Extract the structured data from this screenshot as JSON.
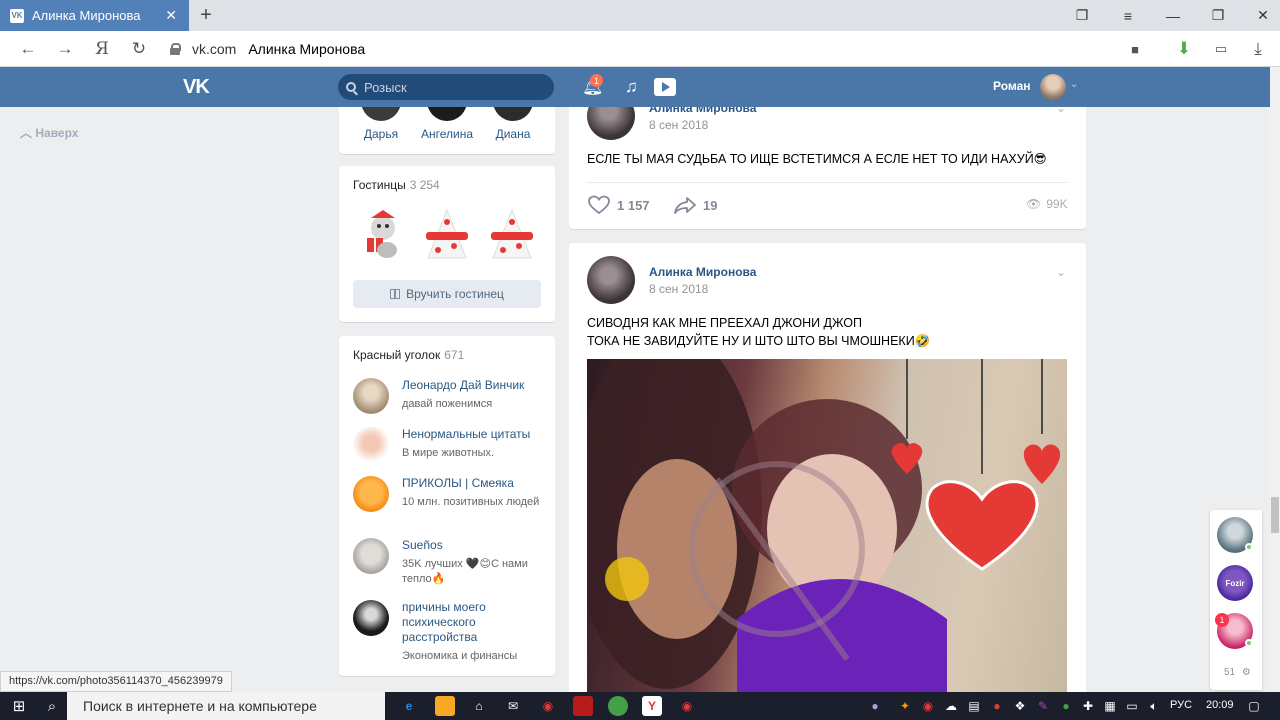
{
  "browser": {
    "tab_title": "Алинка Миронова",
    "tab_favicon": "VK",
    "domain": "vk.com",
    "page_title": "Алинка Миронова",
    "search_engine_label": "Я"
  },
  "header": {
    "search_placeholder": "Розыск",
    "notifications_count": "1",
    "username": "Роман"
  },
  "left": {
    "back_to_top": "Наверх"
  },
  "friends": [
    "Дарья",
    "Ангелина",
    "Диана"
  ],
  "gifts": {
    "title": "Гостинцы",
    "count": "3 254",
    "button_label": "Вручить гостинец"
  },
  "groups": {
    "title": "Красный уголок",
    "count": "671",
    "items": [
      {
        "name": "Леонардо Дай Винчик",
        "desc": "давай поженимся"
      },
      {
        "name": "Ненормальные цитаты",
        "desc": "В мире животных."
      },
      {
        "name": "ПРИКОЛЫ | Смеяка",
        "desc": "10 млн. позитивных людей"
      },
      {
        "name": "Sueños",
        "desc": "35K лучших 🖤😊С нами тепло🔥"
      },
      {
        "name": "причины моего психического расстройства",
        "desc": "Экономика и финансы"
      }
    ]
  },
  "posts": [
    {
      "author": "Алинка Миронова",
      "date": "8 сен 2018",
      "text": "ЕСЛЕ ТЫ МАЯ СУДЬБА ТО ИЩЕ ВСТЕТИМСЯ А ЕСЛЕ НЕТ ТО ИДИ НАХУЙ😎",
      "likes": "1 157",
      "shares": "19",
      "views": "99K"
    },
    {
      "author": "Алинка Миронова",
      "date": "8 сен 2018",
      "text_line1": "СИВОДНЯ КАК МНЕ ПРЕЕХАЛ ДЖОНИ ДЖОП",
      "text_line2": "ТОКА НЕ ЗАВИДУЙТЕ НУ И ШТО ШТО ВЫ ЧМОШНЕКИ🤣"
    }
  ],
  "minipanel": {
    "badge": "1",
    "count": "51",
    "fozir_label": "Fozir"
  },
  "status_url": "https://vk.com/photo356114370_456239979",
  "taskbar": {
    "search_placeholder": "Поиск в интернете и на компьютере",
    "lang": "РУС",
    "time": "20:09"
  },
  "colors": {
    "vk_blue": "#4a76a8",
    "link": "#2a5885"
  }
}
